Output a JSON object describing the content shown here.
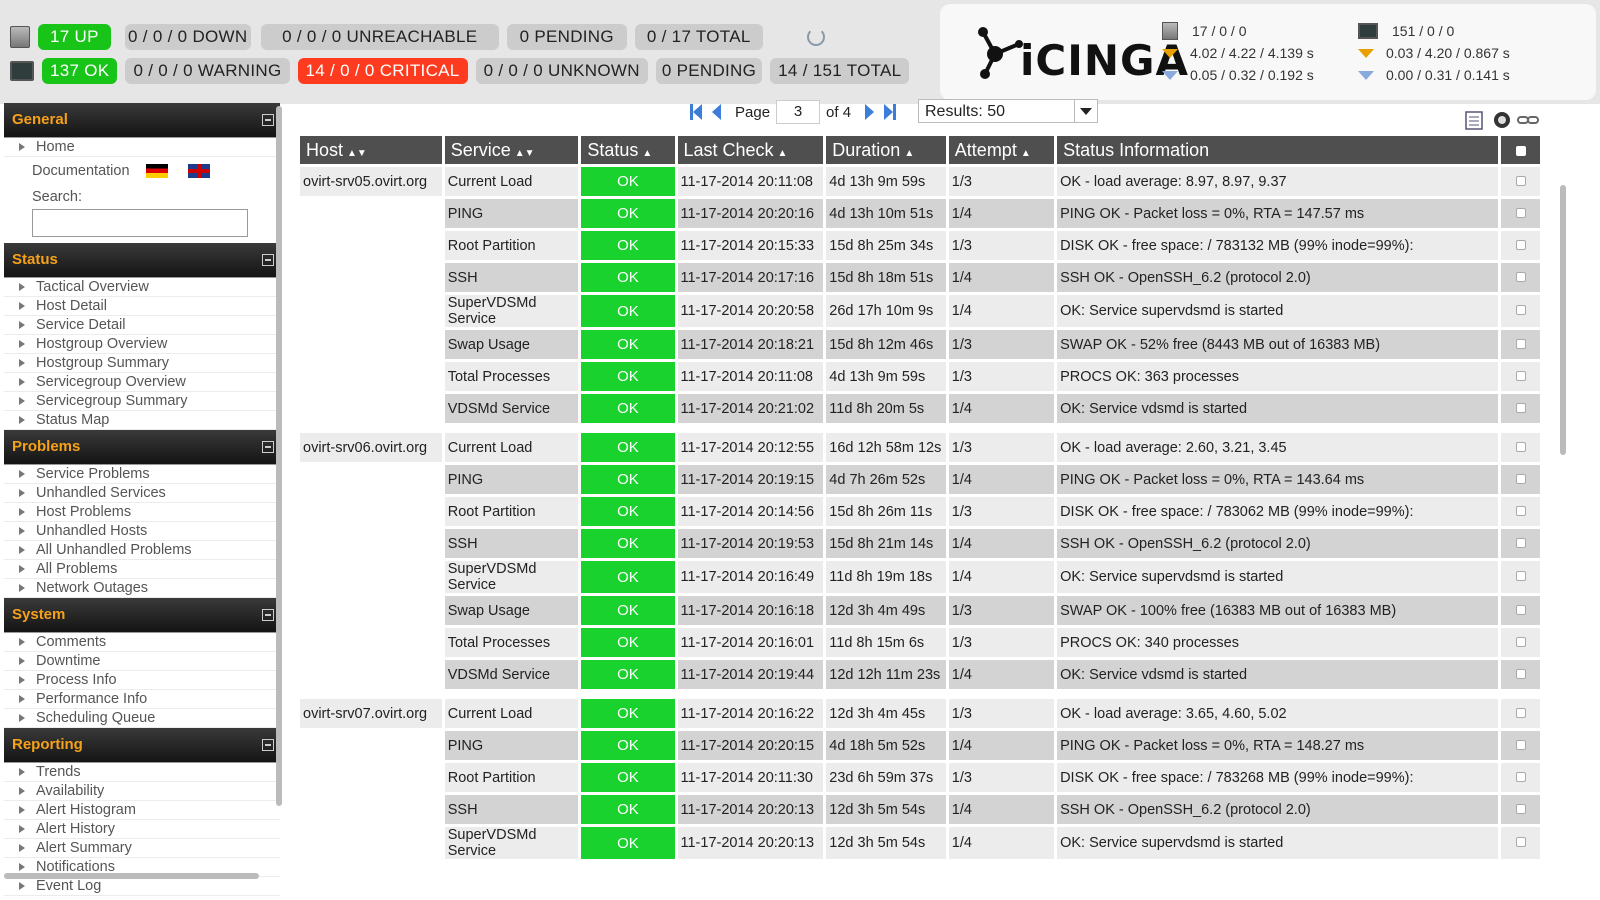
{
  "top": {
    "host_stats": [
      "17 UP",
      "0 / 0 / 0 DOWN",
      "0 / 0 / 0 UNREACHABLE",
      "0 PENDING",
      "0 / 17 TOTAL"
    ],
    "service_stats": [
      "137 OK",
      "0 / 0 / 0 WARNING",
      "14 / 0 / 0 CRITICAL",
      "0 / 0 / 0 UNKNOWN",
      "0 PENDING",
      "14 / 151 TOTAL"
    ],
    "logo_text": "iCINGA",
    "perf_hosts": [
      "17 / 0 / 0",
      "4.02 / 4.22 / 4.139 s",
      "0.05 / 0.32 / 0.192 s"
    ],
    "perf_services": [
      "151 / 0 / 0",
      "0.03 / 4.20 / 0.867 s",
      "0.00 / 0.31 / 0.141 s"
    ]
  },
  "sidebar": {
    "general": {
      "title": "General",
      "home": "Home",
      "documentation": "Documentation",
      "search_label": "Search:"
    },
    "status": {
      "title": "Status",
      "items": [
        "Tactical Overview",
        "Host Detail",
        "Service Detail",
        "Hostgroup Overview",
        "Hostgroup Summary",
        "Servicegroup Overview",
        "Servicegroup Summary",
        "Status Map"
      ]
    },
    "problems": {
      "title": "Problems",
      "items": [
        "Service Problems",
        "Unhandled Services",
        "Host Problems",
        "Unhandled Hosts",
        "All Unhandled Problems",
        "All Problems",
        "Network Outages"
      ]
    },
    "system": {
      "title": "System",
      "items": [
        "Comments",
        "Downtime",
        "Process Info",
        "Performance Info",
        "Scheduling Queue"
      ]
    },
    "reporting": {
      "title": "Reporting",
      "items": [
        "Trends",
        "Availability",
        "Alert Histogram",
        "Alert History",
        "Alert Summary",
        "Notifications",
        "Event Log"
      ]
    }
  },
  "pager": {
    "page_label": "Page",
    "page_value": "3",
    "of_label": "of 4",
    "results": "Results: 50"
  },
  "table": {
    "headers": {
      "host": "Host",
      "service": "Service",
      "status": "Status",
      "last_check": "Last Check",
      "duration": "Duration",
      "attempt": "Attempt",
      "info": "Status Information"
    },
    "groups": [
      {
        "host": "ovirt-srv05.ovirt.org",
        "rows": [
          {
            "service": "Current Load",
            "status": "OK",
            "last": "11-17-2014 20:11:08",
            "dur": "4d 13h 9m 59s",
            "att": "1/3",
            "info": "OK - load average: 8.97, 8.97, 9.37"
          },
          {
            "service": "PING",
            "status": "OK",
            "last": "11-17-2014 20:20:16",
            "dur": "4d 13h 10m 51s",
            "att": "1/4",
            "info": "PING OK - Packet loss = 0%, RTA = 147.57 ms"
          },
          {
            "service": "Root Partition",
            "status": "OK",
            "last": "11-17-2014 20:15:33",
            "dur": "15d 8h 25m 34s",
            "att": "1/3",
            "info": "DISK OK - free space: / 783132 MB (99% inode=99%):"
          },
          {
            "service": "SSH",
            "status": "OK",
            "last": "11-17-2014 20:17:16",
            "dur": "15d 8h 18m 51s",
            "att": "1/4",
            "info": "SSH OK - OpenSSH_6.2 (protocol 2.0)"
          },
          {
            "service": "SuperVDSMd Service",
            "status": "OK",
            "last": "11-17-2014 20:20:58",
            "dur": "26d 17h 10m 9s",
            "att": "1/4",
            "info": "OK: Service supervdsmd is started"
          },
          {
            "service": "Swap Usage",
            "status": "OK",
            "last": "11-17-2014 20:18:21",
            "dur": "15d 8h 12m 46s",
            "att": "1/3",
            "info": "SWAP OK - 52% free (8443 MB out of 16383 MB)"
          },
          {
            "service": "Total Processes",
            "status": "OK",
            "last": "11-17-2014 20:11:08",
            "dur": "4d 13h 9m 59s",
            "att": "1/3",
            "info": "PROCS OK: 363 processes"
          },
          {
            "service": "VDSMd Service",
            "status": "OK",
            "last": "11-17-2014 20:21:02",
            "dur": "11d 8h 20m 5s",
            "att": "1/4",
            "info": "OK: Service vdsmd is started"
          }
        ]
      },
      {
        "host": "ovirt-srv06.ovirt.org",
        "rows": [
          {
            "service": "Current Load",
            "status": "OK",
            "last": "11-17-2014 20:12:55",
            "dur": "16d 12h 58m 12s",
            "att": "1/3",
            "info": "OK - load average: 2.60, 3.21, 3.45"
          },
          {
            "service": "PING",
            "status": "OK",
            "last": "11-17-2014 20:19:15",
            "dur": "4d 7h 26m 52s",
            "att": "1/4",
            "info": "PING OK - Packet loss = 0%, RTA = 143.64 ms"
          },
          {
            "service": "Root Partition",
            "status": "OK",
            "last": "11-17-2014 20:14:56",
            "dur": "15d 8h 26m 11s",
            "att": "1/3",
            "info": "DISK OK - free space: / 783062 MB (99% inode=99%):"
          },
          {
            "service": "SSH",
            "status": "OK",
            "last": "11-17-2014 20:19:53",
            "dur": "15d 8h 21m 14s",
            "att": "1/4",
            "info": "SSH OK - OpenSSH_6.2 (protocol 2.0)"
          },
          {
            "service": "SuperVDSMd Service",
            "status": "OK",
            "last": "11-17-2014 20:16:49",
            "dur": "11d 8h 19m 18s",
            "att": "1/4",
            "info": "OK: Service supervdsmd is started"
          },
          {
            "service": "Swap Usage",
            "status": "OK",
            "last": "11-17-2014 20:16:18",
            "dur": "12d 3h 4m 49s",
            "att": "1/3",
            "info": "SWAP OK - 100% free (16383 MB out of 16383 MB)"
          },
          {
            "service": "Total Processes",
            "status": "OK",
            "last": "11-17-2014 20:16:01",
            "dur": "11d 8h 15m 6s",
            "att": "1/3",
            "info": "PROCS OK: 340 processes"
          },
          {
            "service": "VDSMd Service",
            "status": "OK",
            "last": "11-17-2014 20:19:44",
            "dur": "12d 12h 11m 23s",
            "att": "1/4",
            "info": "OK: Service vdsmd is started"
          }
        ]
      },
      {
        "host": "ovirt-srv07.ovirt.org",
        "rows": [
          {
            "service": "Current Load",
            "status": "OK",
            "last": "11-17-2014 20:16:22",
            "dur": "12d 3h 4m 45s",
            "att": "1/3",
            "info": "OK - load average: 3.65, 4.60, 5.02"
          },
          {
            "service": "PING",
            "status": "OK",
            "last": "11-17-2014 20:20:15",
            "dur": "4d 18h 5m 52s",
            "att": "1/4",
            "info": "PING OK - Packet loss = 0%, RTA = 148.27 ms"
          },
          {
            "service": "Root Partition",
            "status": "OK",
            "last": "11-17-2014 20:11:30",
            "dur": "23d 6h 59m 37s",
            "att": "1/3",
            "info": "DISK OK - free space: / 783268 MB (99% inode=99%):"
          },
          {
            "service": "SSH",
            "status": "OK",
            "last": "11-17-2014 20:20:13",
            "dur": "12d 3h 5m 54s",
            "att": "1/4",
            "info": "SSH OK - OpenSSH_6.2 (protocol 2.0)"
          },
          {
            "service": "SuperVDSMd Service",
            "status": "OK",
            "last": "11-17-2014 20:20:13",
            "dur": "12d 3h 5m 54s",
            "att": "1/4",
            "info": "OK: Service supervdsmd is started"
          }
        ]
      }
    ]
  },
  "colors": {
    "ok": "#19d22e",
    "critical": "#ff3b1f",
    "up": "#19c419",
    "section_title": "#f5a11a",
    "header_bg": "#4f4f4f"
  }
}
